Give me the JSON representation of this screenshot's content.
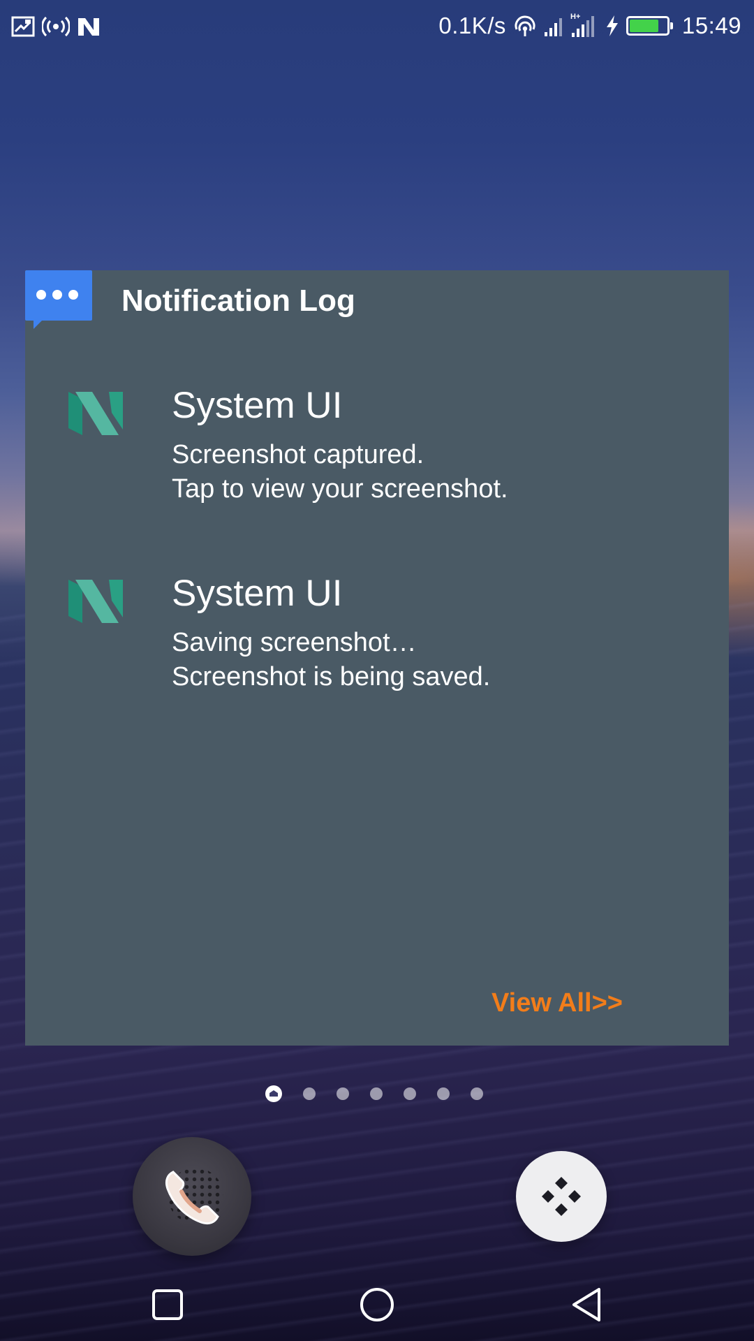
{
  "status_bar": {
    "left_icons": [
      "screenshot-icon",
      "hotspot-icon",
      "android-n-icon"
    ],
    "net_speed": "0.1K/s",
    "right_icons": [
      "wifi-icon",
      "signal-icon",
      "signal-hplus-icon",
      "charging-icon",
      "battery-icon"
    ],
    "battery_level": 0.8,
    "battery_color": "#43d24a",
    "time": "15:49"
  },
  "widget": {
    "badge_icon": "chat-bubble-icon",
    "title": "Notification Log",
    "notifications": [
      {
        "icon": "android-n-logo-icon",
        "app": "System UI",
        "line1": "Screenshot captured.",
        "line2": "Tap to view your screenshot."
      },
      {
        "icon": "android-n-logo-icon",
        "app": "System UI",
        "line1": "Saving screenshot…",
        "line2": "Screenshot is being saved."
      }
    ],
    "view_all": "View All>>",
    "accent_color": "#f27d1a",
    "background_color": "#4a5a65"
  },
  "page_indicator": {
    "total": 7,
    "current": 1,
    "first_is_home": true
  },
  "dock": {
    "left_app_icon": "phone-icon",
    "right_app_icon": "app-drawer-icon"
  },
  "nav_bar": {
    "buttons": [
      "recents-icon",
      "home-icon",
      "back-icon"
    ]
  }
}
